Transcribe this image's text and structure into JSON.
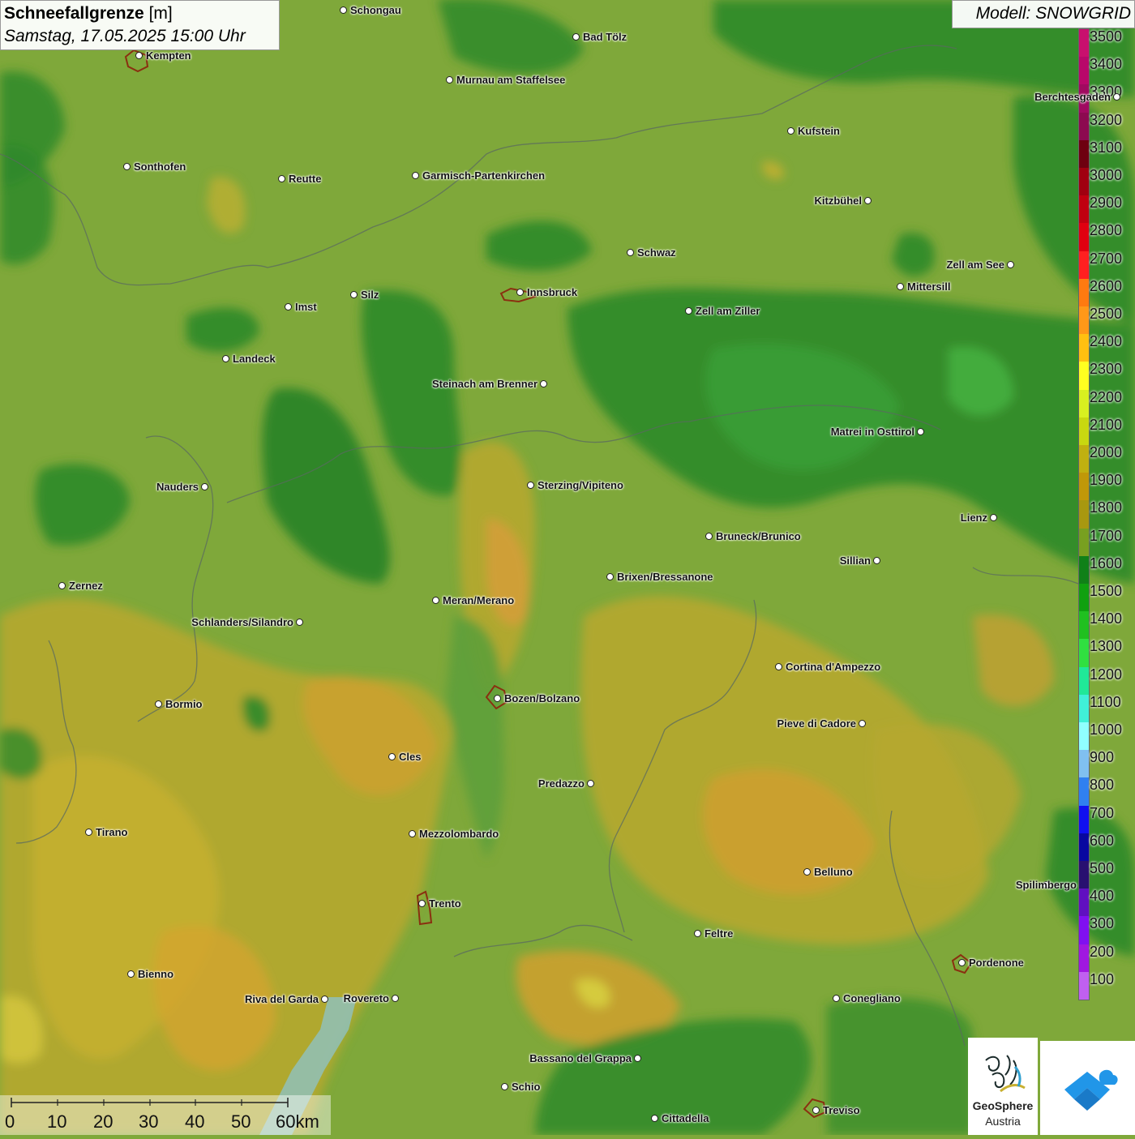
{
  "title": {
    "variable": "Schneefallgrenze",
    "unit": "[m]",
    "datetime": "Samstag, 17.05.2025 15:00 Uhr"
  },
  "model": "Modell: SNOWGRID",
  "legend": {
    "entries": [
      {
        "value": "3500",
        "color": "#c8106e"
      },
      {
        "value": "3400",
        "color": "#b8086a"
      },
      {
        "value": "3300",
        "color": "#a00a60"
      },
      {
        "value": "3200",
        "color": "#8c0a50"
      },
      {
        "value": "3100",
        "color": "#6e0010"
      },
      {
        "value": "3000",
        "color": "#a00010"
      },
      {
        "value": "2900",
        "color": "#c00010"
      },
      {
        "value": "2800",
        "color": "#e00010"
      },
      {
        "value": "2700",
        "color": "#ff2020"
      },
      {
        "value": "2600",
        "color": "#ff7a10"
      },
      {
        "value": "2500",
        "color": "#ff9818"
      },
      {
        "value": "2400",
        "color": "#ffc010"
      },
      {
        "value": "2300",
        "color": "#ffff20"
      },
      {
        "value": "2200",
        "color": "#d8f020"
      },
      {
        "value": "2100",
        "color": "#c8d810"
      },
      {
        "value": "2000",
        "color": "#c0b010"
      },
      {
        "value": "1900",
        "color": "#c09808"
      },
      {
        "value": "1800",
        "color": "#a89810"
      },
      {
        "value": "1700",
        "color": "#78a020"
      },
      {
        "value": "1600",
        "color": "#108018"
      },
      {
        "value": "1500",
        "color": "#10a010"
      },
      {
        "value": "1400",
        "color": "#20c020"
      },
      {
        "value": "1300",
        "color": "#30e040"
      },
      {
        "value": "1200",
        "color": "#20e898"
      },
      {
        "value": "1100",
        "color": "#40f0d8"
      },
      {
        "value": "1000",
        "color": "#90ffff"
      },
      {
        "value": "900",
        "color": "#80c0f0"
      },
      {
        "value": "800",
        "color": "#3080f0"
      },
      {
        "value": "700",
        "color": "#1010f0"
      },
      {
        "value": "600",
        "color": "#0808a0"
      },
      {
        "value": "500",
        "color": "#281070"
      },
      {
        "value": "400",
        "color": "#6010c0"
      },
      {
        "value": "300",
        "color": "#8010f0"
      },
      {
        "value": "200",
        "color": "#a018e0"
      },
      {
        "value": "100",
        "color": "#c060f0"
      }
    ]
  },
  "cities": [
    {
      "name": "Schongau",
      "side": "right"
    },
    {
      "name": "Bad Tölz",
      "side": "right"
    },
    {
      "name": "Kempten",
      "side": "right"
    },
    {
      "name": "Murnau am Staffelsee",
      "side": "right"
    },
    {
      "name": "Berchtesgaden",
      "side": "left"
    },
    {
      "name": "Kufstein",
      "side": "right"
    },
    {
      "name": "Sonthofen",
      "side": "right"
    },
    {
      "name": "Reutte",
      "side": "right"
    },
    {
      "name": "Garmisch-Partenkirchen",
      "side": "right"
    },
    {
      "name": "Kitzbühel",
      "side": "left"
    },
    {
      "name": "Schwaz",
      "side": "right"
    },
    {
      "name": "Zell am See",
      "side": "left"
    },
    {
      "name": "Innsbruck",
      "side": "right"
    },
    {
      "name": "Mittersill",
      "side": "right"
    },
    {
      "name": "Imst",
      "side": "right"
    },
    {
      "name": "Silz",
      "side": "right"
    },
    {
      "name": "Zell am Ziller",
      "side": "right"
    },
    {
      "name": "Landeck",
      "side": "right"
    },
    {
      "name": "Steinach am Brenner",
      "side": "left"
    },
    {
      "name": "Matrei in Osttirol",
      "side": "left"
    },
    {
      "name": "Nauders",
      "side": "left"
    },
    {
      "name": "Sterzing/Vipiteno",
      "side": "right"
    },
    {
      "name": "Lienz",
      "side": "left"
    },
    {
      "name": "Bruneck/Brunico",
      "side": "right"
    },
    {
      "name": "Sillian",
      "side": "left"
    },
    {
      "name": "Zernez",
      "side": "right"
    },
    {
      "name": "Brixen/Bressanone",
      "side": "right"
    },
    {
      "name": "Meran/Merano",
      "side": "right"
    },
    {
      "name": "Schlanders/Silandro",
      "side": "left"
    },
    {
      "name": "Cortina d'Ampezzo",
      "side": "right"
    },
    {
      "name": "Bormio",
      "side": "right"
    },
    {
      "name": "Bozen/Bolzano",
      "side": "right"
    },
    {
      "name": "Pieve di Cadore",
      "side": "left"
    },
    {
      "name": "Cles",
      "side": "right"
    },
    {
      "name": "Predazzo",
      "side": "left"
    },
    {
      "name": "Tirano",
      "side": "right"
    },
    {
      "name": "Mezzolombardo",
      "side": "right"
    },
    {
      "name": "Belluno",
      "side": "right"
    },
    {
      "name": "Trento",
      "side": "right"
    },
    {
      "name": "Feltre",
      "side": "right"
    },
    {
      "name": "Pordenone",
      "side": "right"
    },
    {
      "name": "Bienno",
      "side": "right"
    },
    {
      "name": "Riva del Garda",
      "side": "left"
    },
    {
      "name": "Rovereto",
      "side": "left"
    },
    {
      "name": "Conegliano",
      "side": "right"
    },
    {
      "name": "Bassano del Grappa",
      "side": "left"
    },
    {
      "name": "Schio",
      "side": "right"
    },
    {
      "name": "Treviso",
      "side": "right"
    },
    {
      "name": "Cittadella",
      "side": "right"
    },
    {
      "name": "Spilimbergo",
      "side": "right"
    }
  ],
  "scale": {
    "ticks": [
      "0",
      "10",
      "20",
      "30",
      "40",
      "50",
      "60km"
    ]
  },
  "logos": {
    "geosphere": "GeoSphere",
    "austria": "Austria"
  }
}
